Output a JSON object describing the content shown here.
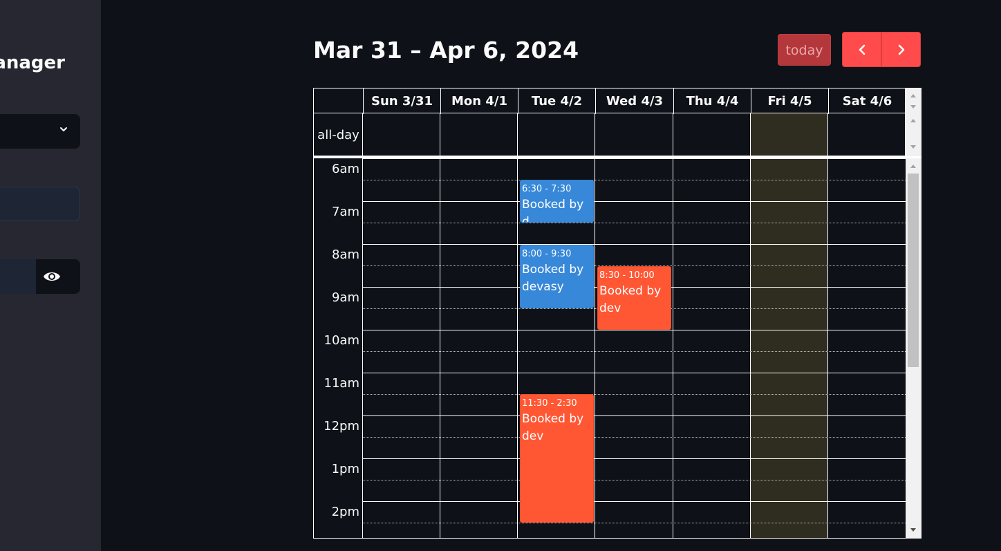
{
  "sidebar": {
    "title": "lanager"
  },
  "calendar": {
    "title": "Mar 31 – Apr 6, 2024",
    "today_label": "today",
    "allday_label": "all-day",
    "days": [
      "Sun 3/31",
      "Mon 4/1",
      "Tue 4/2",
      "Wed 4/3",
      "Thu 4/4",
      "Fri 4/5",
      "Sat 4/6"
    ],
    "time_labels": [
      "6am",
      "7am",
      "8am",
      "9am",
      "10am",
      "11am",
      "12pm",
      "1pm",
      "2pm"
    ],
    "events": [
      {
        "time": "6:30 - 7:30",
        "title": "Booked by d",
        "color": "#3788d8"
      },
      {
        "time": "8:00 - 9:30",
        "title": "Booked by devasy",
        "color": "#3788d8"
      },
      {
        "time": "8:30 - 10:00",
        "title": "Booked by dev",
        "color": "#ff5733"
      },
      {
        "time": "11:30 - 2:30",
        "title": "Booked by dev",
        "color": "#ff5733"
      }
    ],
    "today_highlight_color": "#2f2d20"
  },
  "colors": {
    "accent": "#ff4b4b",
    "background": "#0e1117",
    "sidebar": "#262730"
  }
}
